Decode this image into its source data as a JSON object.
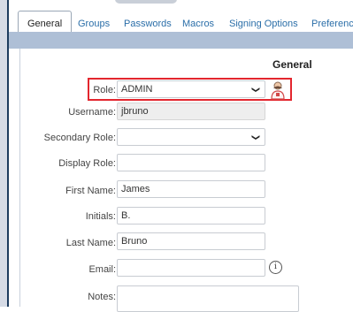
{
  "tabs": [
    {
      "label": "General",
      "active": true
    },
    {
      "label": "Groups",
      "active": false
    },
    {
      "label": "Passwords",
      "active": false
    },
    {
      "label": "Macros",
      "active": false
    },
    {
      "label": "Signing Options",
      "active": false
    },
    {
      "label": "Preference",
      "active": false
    }
  ],
  "section_title": "General",
  "form": {
    "role": {
      "label": "Role:",
      "value": "ADMIN"
    },
    "username": {
      "label": "Username:",
      "value": "jbruno"
    },
    "secondary_role": {
      "label": "Secondary Role:",
      "value": ""
    },
    "display_role": {
      "label": "Display Role:",
      "value": ""
    },
    "first_name": {
      "label": "First Name:",
      "value": "James"
    },
    "initials": {
      "label": "Initials:",
      "value": "B."
    },
    "last_name": {
      "label": "Last Name:",
      "value": "Bruno"
    },
    "email": {
      "label": "Email:",
      "value": ""
    },
    "notes": {
      "label": "Notes:",
      "value": ""
    }
  },
  "icons": {
    "role_icon": "user-role-icon",
    "info_icon": "info-icon",
    "select_chevron": "chevron-down-icon"
  },
  "colors": {
    "highlight": "#e3262e",
    "tab_link": "#2a6ea8",
    "band": "#aebfd6",
    "frame": "#1d3b5e"
  }
}
